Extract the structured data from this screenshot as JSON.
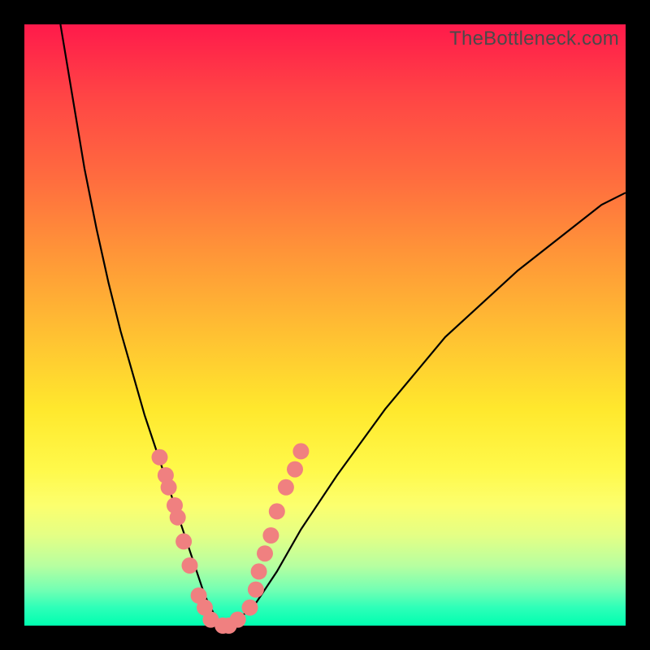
{
  "watermark": "TheBottleneck.com",
  "chart_data": {
    "type": "line",
    "title": "",
    "xlabel": "",
    "ylabel": "",
    "xlim": [
      0,
      100
    ],
    "ylim": [
      0,
      100
    ],
    "grid": false,
    "background": "red-yellow-green vertical gradient (high=red, low=green)",
    "series": [
      {
        "name": "bottleneck-curve",
        "x": [
          6,
          8,
          10,
          12,
          14,
          16,
          18,
          20,
          22,
          24,
          26,
          28,
          30,
          32,
          34,
          38,
          42,
          46,
          52,
          60,
          70,
          82,
          96,
          100
        ],
        "y": [
          100,
          88,
          76,
          66,
          57,
          49,
          42,
          35,
          29,
          23,
          17,
          11,
          5,
          1,
          0,
          3,
          9,
          16,
          25,
          36,
          48,
          59,
          70,
          72
        ]
      }
    ],
    "markers": {
      "name": "highlighted-points",
      "x": [
        22.5,
        23.5,
        24.0,
        25.0,
        25.5,
        26.5,
        27.5,
        29.0,
        30.0,
        31.0,
        33.0,
        34.0,
        35.5,
        37.5,
        38.5,
        39.0,
        40.0,
        41.0,
        42.0,
        43.5,
        45.0,
        46.0
      ],
      "y": [
        28,
        25,
        23,
        20,
        18,
        14,
        10,
        5,
        3,
        1,
        0,
        0,
        1,
        3,
        6,
        9,
        12,
        15,
        19,
        23,
        26,
        29
      ],
      "color": "#f08080",
      "size": 10
    }
  },
  "colors": {
    "frame": "#000000",
    "curve": "#000000",
    "marker": "#f08080",
    "gradient_top": "#ff1a4b",
    "gradient_mid": "#ffe82d",
    "gradient_bottom": "#00ffb0"
  }
}
